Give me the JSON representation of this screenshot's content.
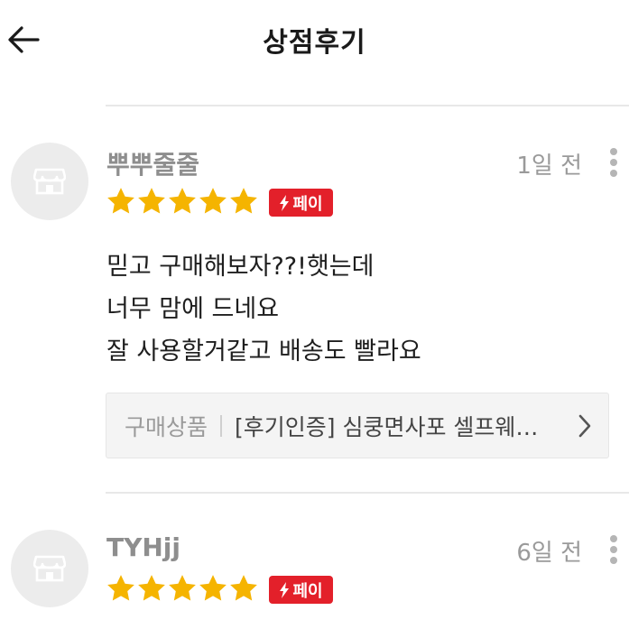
{
  "header": {
    "title": "상점후기"
  },
  "reviews": [
    {
      "username": "뿌뿌줄줄",
      "date": "1일 전",
      "rating": 5,
      "pay_badge": "페이",
      "lines": [
        "믿고 구매해보자??!햇는데",
        "너무 맘에 드네요",
        "잘 사용할거같고 배송도 빨라요"
      ],
      "product_label": "구매상품",
      "product_name": "[후기인증] 심쿵면사포 셀프웨…"
    },
    {
      "username": "TYHjj",
      "date": "6일 전",
      "rating": 5,
      "pay_badge": "페이"
    }
  ],
  "colors": {
    "star": "#f5b400",
    "pay_badge": "#e3202a",
    "divider": "#e8e8e8"
  },
  "icons": {
    "back": "back-arrow-icon",
    "avatar": "store-icon",
    "more": "more-vertical-icon",
    "pay": "lightning-icon",
    "chevron": "chevron-right-icon"
  }
}
